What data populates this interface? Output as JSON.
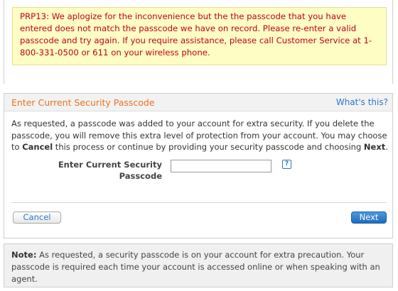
{
  "error": {
    "message": "PRP13: We aplogize for the inconvenience but the the passcode that you have entered does not match the passcode we have on record. Please re-enter a valid passcode and try again. If you require assistance, please call Customer Service at 1-800-331-0500 or 611 on your wireless phone."
  },
  "panel": {
    "title": "Enter Current Security Passcode",
    "help_link": "What's this?",
    "description_before": "As requested, a passcode was added to your account for extra security. If you delete the passcode, you will remove this extra level of protection from your account. You may choose to ",
    "description_cancel": "Cancel",
    "description_middle": " this process or continue by providing your security passcode and choosing ",
    "description_next": "Next",
    "description_end": ".",
    "field_label_line1": "Enter Current Security",
    "field_label_line2": "Passcode",
    "input_value": "",
    "help_icon_glyph": "?",
    "cancel_label": "Cancel",
    "next_label": "Next"
  },
  "note": {
    "label": "Note:",
    "text": " As requested, a security passcode is on your account for extra precaution. Your passcode is required each time your account is accessed online or when speaking with an agent."
  },
  "colors": {
    "error_text": "#c0001a",
    "error_bg": "#fdfdc4",
    "title_orange": "#e8731e",
    "link_blue": "#2b79c9"
  }
}
